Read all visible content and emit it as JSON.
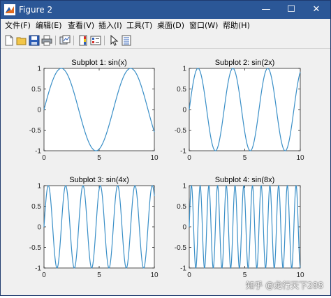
{
  "window": {
    "title": "Figure 2",
    "controls": {
      "minimize": "—",
      "maximize": "☐",
      "close": "✕"
    }
  },
  "menu": {
    "items": [
      "文件(F)",
      "编辑(E)",
      "查看(V)",
      "插入(I)",
      "工具(T)",
      "桌面(D)",
      "窗口(W)",
      "帮助(H)"
    ]
  },
  "toolbar": {
    "buttons": [
      "new-figure-icon",
      "open-file-icon",
      "save-icon",
      "print-icon",
      "link-plot-icon",
      "insert-colorbar-icon",
      "insert-legend-icon",
      "pointer-icon",
      "property-inspector-icon"
    ]
  },
  "colors": {
    "line": "#3a8fc7",
    "titlebar": "#2b5797",
    "axes_bg": "#ffffff"
  },
  "chart_data": [
    {
      "type": "line",
      "title": "Subplot 1: sin(x)",
      "frequency": 1,
      "xlim": [
        0,
        10
      ],
      "ylim": [
        -1,
        1
      ],
      "xticks": [
        "0",
        "5",
        "10"
      ],
      "yticks": [
        "1",
        "0.5",
        "0",
        "-0.5",
        "-1"
      ]
    },
    {
      "type": "line",
      "title": "Subplot 2: sin(2x)",
      "frequency": 2,
      "xlim": [
        0,
        10
      ],
      "ylim": [
        -1,
        1
      ],
      "xticks": [
        "0",
        "5",
        "10"
      ],
      "yticks": [
        "1",
        "0.5",
        "0",
        "-0.5",
        "-1"
      ]
    },
    {
      "type": "line",
      "title": "Subplot 3: sin(4x)",
      "frequency": 4,
      "xlim": [
        0,
        10
      ],
      "ylim": [
        -1,
        1
      ],
      "xticks": [
        "0",
        "5",
        "10"
      ],
      "yticks": [
        "1",
        "0.5",
        "0",
        "-0.5",
        "-1"
      ]
    },
    {
      "type": "line",
      "title": "Subplot 4: sin(8x)",
      "frequency": 8,
      "xlim": [
        0,
        10
      ],
      "ylim": [
        -1,
        1
      ],
      "xticks": [
        "0",
        "5",
        "10"
      ],
      "yticks": [
        "1",
        "0.5",
        "0",
        "-0.5",
        "-1"
      ]
    }
  ],
  "watermark": "知乎 @龙行天下288"
}
